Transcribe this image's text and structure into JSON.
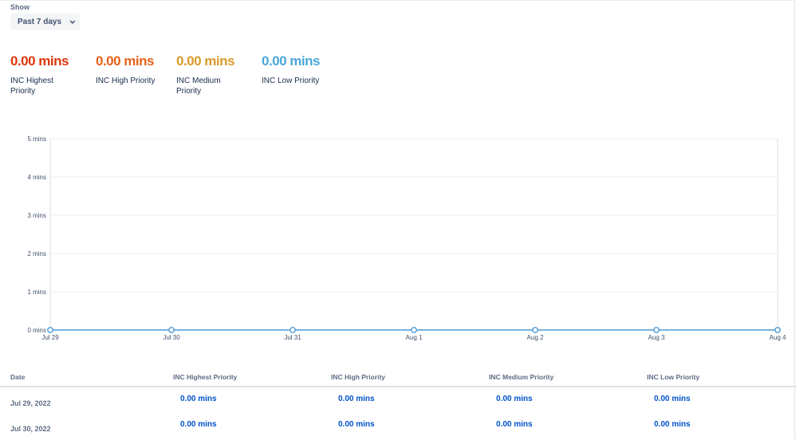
{
  "filter": {
    "label": "Show",
    "selected": "Past 7 days"
  },
  "stats": [
    {
      "value": "0.00 mins",
      "label": "INC Highest Priority",
      "color": "#de350b"
    },
    {
      "value": "0.00 mins",
      "label": "INC High Priority",
      "color": "#e8611a"
    },
    {
      "value": "0.00 mins",
      "label": "INC Medium Priority",
      "color": "#d99a2b"
    },
    {
      "value": "0.00 mins",
      "label": "INC Low Priority",
      "color": "#4ba8d8"
    }
  ],
  "chart_data": {
    "type": "line",
    "x": [
      "Jul 29",
      "Jul 30",
      "Jul 31",
      "Aug 1",
      "Aug 2",
      "Aug 3",
      "Aug 4"
    ],
    "y_ticks": [
      "0 mins",
      "1 mins",
      "2 mins",
      "3 mins",
      "4 mins",
      "5 mins"
    ],
    "ylim": [
      0,
      5
    ],
    "series": [
      {
        "values": [
          0,
          0,
          0,
          0,
          0,
          0,
          0
        ],
        "color": "#4d9ad6"
      }
    ],
    "grid": true
  },
  "table": {
    "headers": [
      "Date",
      "INC Highest Priority",
      "INC High Priority",
      "INC Medium Priority",
      "INC Low Priority"
    ],
    "rows": [
      {
        "date": "Jul 29, 2022",
        "values": [
          "0.00 mins",
          "0.00 mins",
          "0.00 mins",
          "0.00 mins"
        ]
      },
      {
        "date": "Jul 30, 2022",
        "values": [
          "0.00 mins",
          "0.00 mins",
          "0.00 mins",
          "0.00 mins"
        ]
      }
    ]
  }
}
